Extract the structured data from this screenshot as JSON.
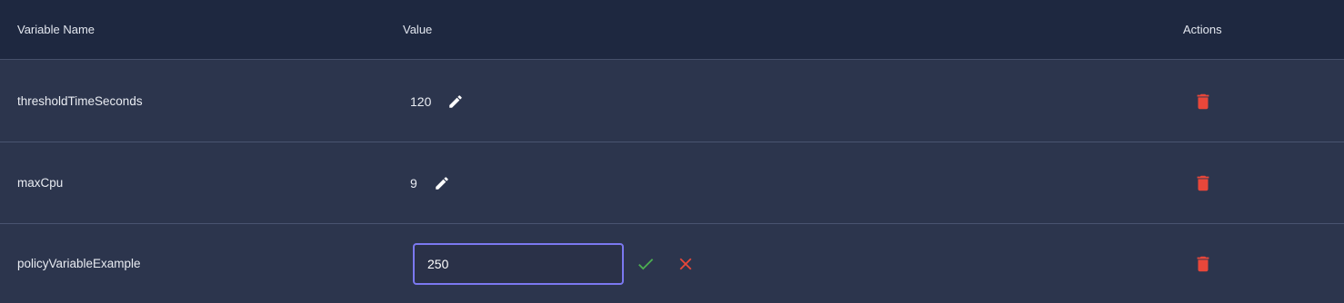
{
  "header": {
    "name_label": "Variable Name",
    "value_label": "Value",
    "actions_label": "Actions"
  },
  "rows": [
    {
      "name": "thresholdTimeSeconds",
      "value": "120",
      "editing": false
    },
    {
      "name": "maxCpu",
      "value": "9",
      "editing": false
    },
    {
      "name": "policyVariableExample",
      "value": "250",
      "editing": true
    }
  ],
  "icons": {
    "edit": "pencil-icon",
    "delete": "trash-icon",
    "confirm": "check-icon",
    "cancel": "close-icon"
  },
  "colors": {
    "header_bg": "#1e2840",
    "row_bg": "#2c354d",
    "delete": "#e8473a",
    "confirm": "#4caf50",
    "cancel": "#e8473a",
    "input_border": "#7b78f0"
  }
}
